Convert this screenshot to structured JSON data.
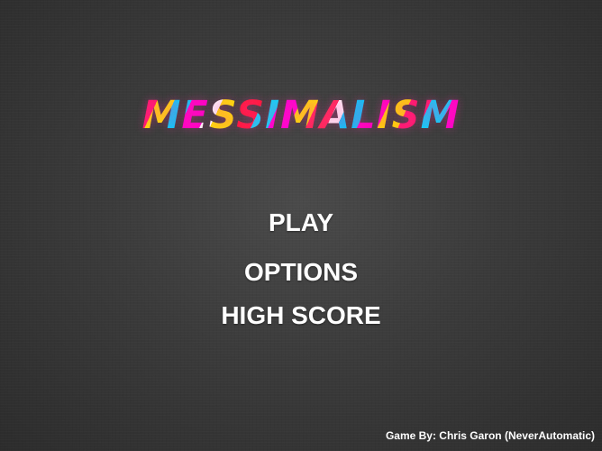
{
  "game": {
    "title": "MESSIMALISM"
  },
  "menu": {
    "play": "PLAY",
    "options": "OPTIONS",
    "high_score": "HIGH SCORE"
  },
  "footer": {
    "credit": "Game By: Chris Garon (NeverAutomatic)"
  },
  "colors": {
    "background": "#3b3b3b",
    "menu_text": "#ffffff",
    "logo_pink": "#ff1a6b",
    "logo_yellow": "#ffe600",
    "logo_cyan": "#00d2ff",
    "logo_magenta": "#ff00c8"
  }
}
